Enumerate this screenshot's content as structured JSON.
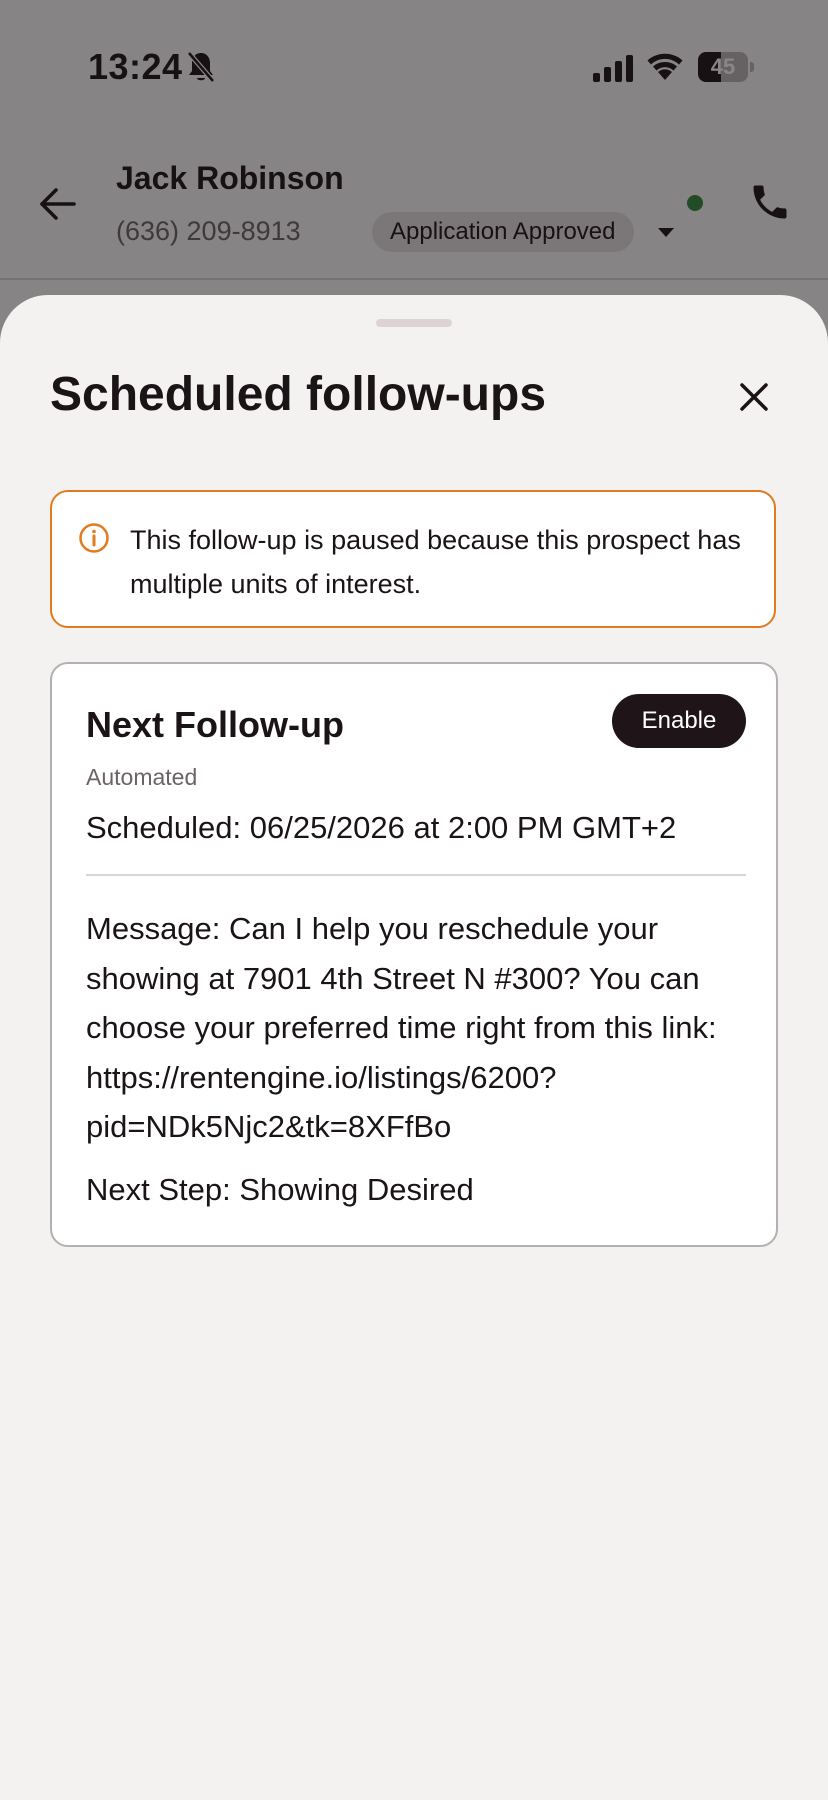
{
  "status_bar": {
    "time": "13:24",
    "battery": "45",
    "battery_level": 0.45
  },
  "header": {
    "contact_name": "Jack Robinson",
    "contact_phone": "(636) 209-8913",
    "status_label": "Application Approved",
    "online_color": "#2e8b3a"
  },
  "sheet": {
    "title": "Scheduled follow-ups",
    "notice": {
      "text": "This follow-up is paused because this prospect has multiple units of interest.",
      "border_color": "#e07b1e",
      "icon": "info-icon"
    },
    "card": {
      "title": "Next Follow-up",
      "enable_label": "Enable",
      "type": "Automated",
      "scheduled": "Scheduled: 06/25/2026 at 2:00 PM GMT+2",
      "message": "Message: Can I help you reschedule your showing at 7901 4th Street N #300? You can choose your preferred time right from this link: https://rentengine.io/listings/6200?pid=NDk5Njc2&tk=8XFfBo",
      "next_step": "Next Step: Showing Desired"
    }
  },
  "icons": [
    "bell-muted-icon",
    "signal-icon",
    "wifi-icon",
    "battery-icon",
    "back-arrow-icon",
    "chevron-down-icon",
    "phone-icon",
    "close-icon",
    "info-icon"
  ]
}
